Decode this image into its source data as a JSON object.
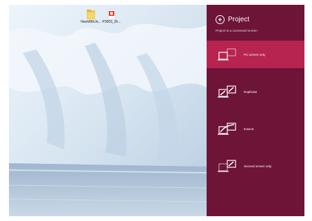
{
  "desktop": {
    "icons": [
      {
        "name": "folder-icon",
        "label": "NewWithJo..."
      },
      {
        "name": "document-icon",
        "label": "P3003_3h..."
      }
    ]
  },
  "panel": {
    "title": "Project",
    "subtitle": "Project to a connected screen",
    "options": [
      {
        "label": "PC screen only",
        "icon": "pc-screen-only-icon",
        "selected": true
      },
      {
        "label": "Duplicate",
        "icon": "duplicate-icon",
        "selected": false
      },
      {
        "label": "Extend",
        "icon": "extend-icon",
        "selected": false
      },
      {
        "label": "Second screen only",
        "icon": "second-screen-only-icon",
        "selected": false
      }
    ]
  },
  "colors": {
    "panel_bg": "#6d1437",
    "selected_bg": "#b6244f",
    "text": "#ffffff"
  }
}
